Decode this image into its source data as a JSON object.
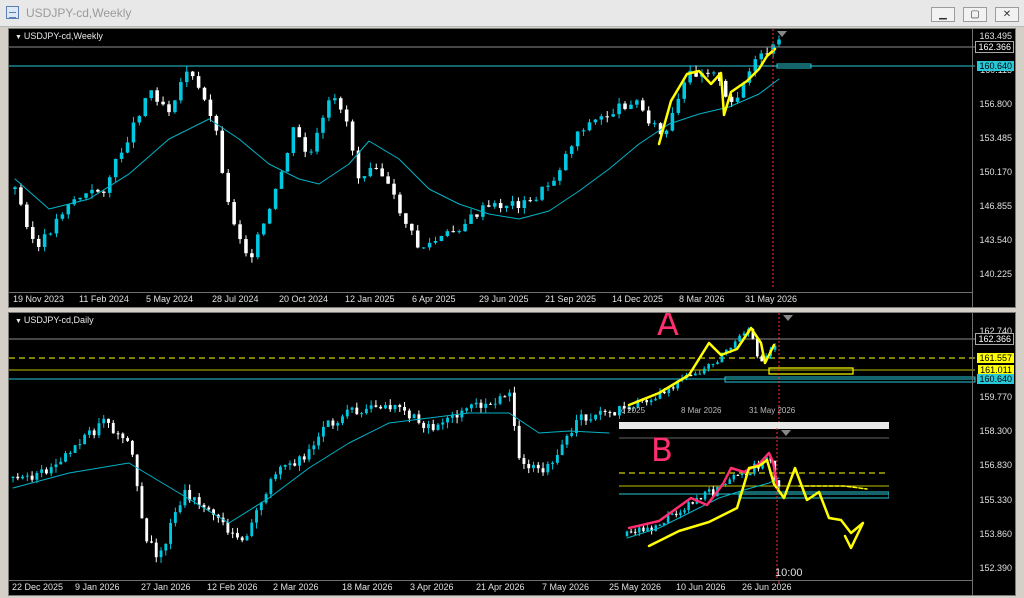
{
  "window": {
    "title": "USDJPY-cd,Weekly",
    "min_label": "▁",
    "max_label": "▢",
    "close_label": "✕"
  },
  "weekly": {
    "symbol": "USDJPY-cd,Weekly",
    "y_ticks": [
      "163.495",
      "160.115",
      "156.800",
      "153.485",
      "150.170",
      "146.855",
      "143.540",
      "140.225"
    ],
    "price_label": "162.366",
    "level_label": "160.640",
    "x_ticks": [
      "19 Nov 2023",
      "11 Feb 2024",
      "5 May 2024",
      "28 Jul 2024",
      "20 Oct 2024",
      "12 Jan 2025",
      "6 Apr 2025",
      "29 Jun 2025",
      "21 Sep 2025",
      "14 Dec 2025",
      "8 Mar 2026",
      "31 May 2026"
    ]
  },
  "daily": {
    "symbol": "USDJPY-cd,Daily",
    "y_ticks": [
      "162.740",
      "159.770",
      "158.300",
      "156.830",
      "155.330",
      "153.860",
      "152.390"
    ],
    "price_label": "162.366",
    "yellow_label": "161.557",
    "yellow2_label": "161.011",
    "level_label": "160.640",
    "x_ticks": [
      "22 Dec 2025",
      "9 Jan 2026",
      "27 Jan 2026",
      "12 Feb 2026",
      "2 Mar 2026",
      "18 Mar 2026",
      "3 Apr 2026",
      "21 Apr 2026",
      "7 May 2026",
      "25 May 2026",
      "10 Jun 2026",
      "26 Jun 2026"
    ],
    "annotation_a": "A",
    "annotation_b": "B",
    "inset_time": "10:00",
    "mini_dates": [
      "c 2025",
      "8 Mar 2026",
      "31 May 2026"
    ]
  },
  "colors": {
    "bull": "#00c8e0",
    "bear": "#ffffff",
    "ma": "#00b4c8",
    "hline": "#28c8d8",
    "yellow": "#ffff00",
    "pink": "#ff2e6e"
  }
}
